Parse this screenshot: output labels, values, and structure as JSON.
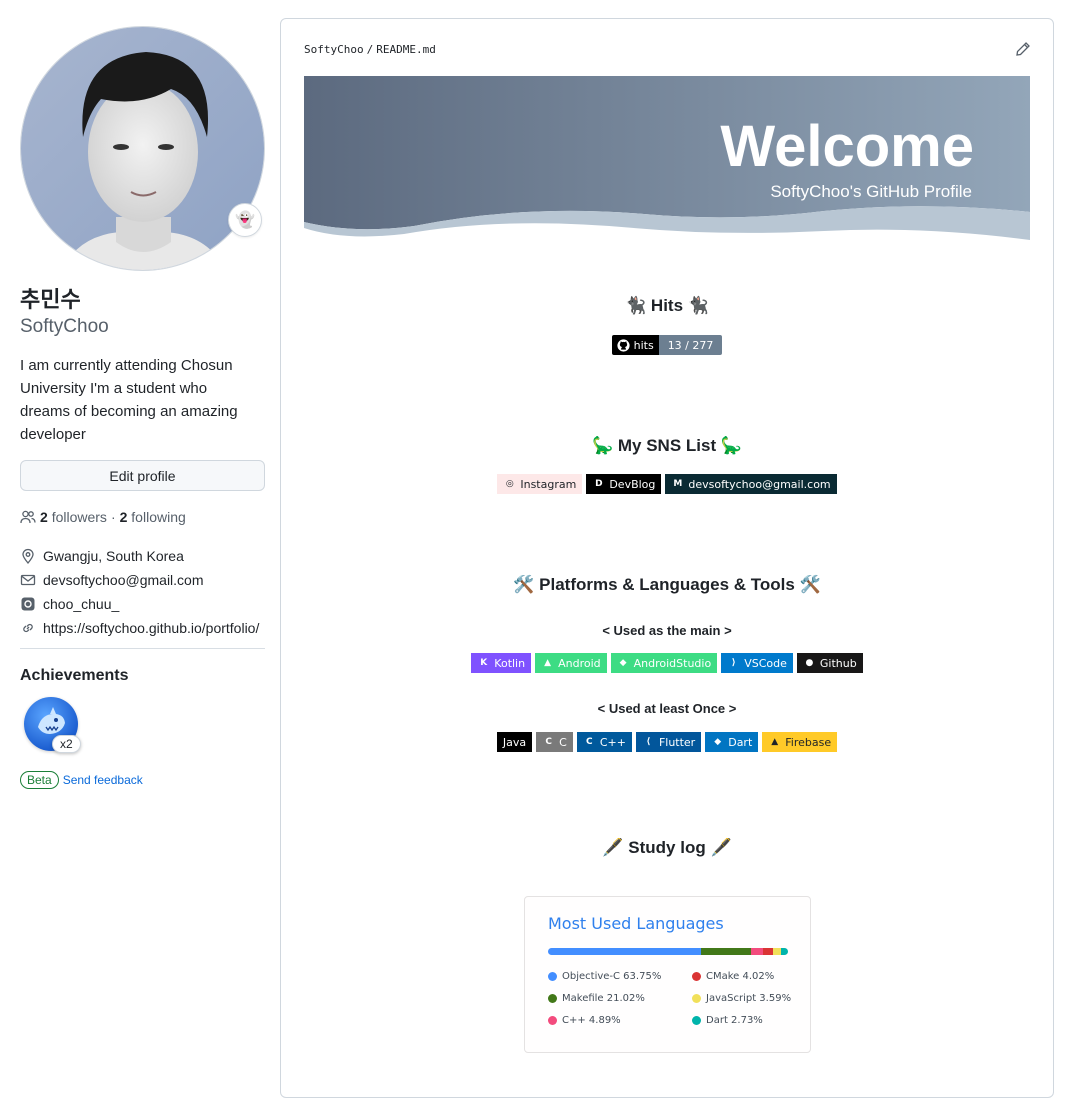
{
  "profile": {
    "full_name": "추민수",
    "username": "SoftyChoo",
    "bio": "I am currently attending Chosun University I'm a student who dreams of becoming an amazing developer",
    "edit_label": "Edit profile",
    "followers_count": "2",
    "followers_label": "followers",
    "separator": "·",
    "following_count": "2",
    "following_label": "following",
    "status_emoji": "👻",
    "details": {
      "location": "Gwangju, South Korea",
      "email": "devsoftychoo@gmail.com",
      "instagram": "choo_chuu_",
      "website": "https://softychoo.github.io/portfolio/"
    },
    "achievements_title": "Achievements",
    "achievement_count": "x2",
    "beta_label": "Beta",
    "feedback_label": "Send feedback"
  },
  "readme": {
    "owner": "SoftyChoo",
    "separator": "/",
    "file": "README.md",
    "banner_title": "Welcome",
    "banner_subtitle": "SoftyChoo's GitHub Profile",
    "hits": {
      "title": "🐈‍⬛ Hits 🐈‍⬛",
      "badge_label": "hits",
      "badge_value": "13 / 277"
    },
    "sns": {
      "title": "🦕 My SNS List 🦕",
      "badges": [
        {
          "label": "Instagram",
          "bg": "#fde8e8",
          "fg": "#1f2328",
          "icon": "instagram-icon"
        },
        {
          "label": "DevBlog",
          "bg": "#000000",
          "fg": "#ffffff",
          "icon": "devblog-icon"
        },
        {
          "label": "devsoftychoo@gmail.com",
          "bg": "#0a2a33",
          "fg": "#ffffff",
          "icon": "gmail-icon"
        }
      ]
    },
    "platforms": {
      "title": "🛠️ Platforms & Languages & Tools 🛠️",
      "main_title": "< Used as the main >",
      "main_badges": [
        {
          "label": "Kotlin",
          "bg": "#7f52ff",
          "icon": "kotlin-icon"
        },
        {
          "label": "Android",
          "bg": "#3ddc84",
          "icon": "android-icon"
        },
        {
          "label": "AndroidStudio",
          "bg": "#3ddc84",
          "icon": "androidstudio-icon"
        },
        {
          "label": "VSCode",
          "bg": "#007acc",
          "icon": "vscode-icon"
        },
        {
          "label": "Github",
          "bg": "#181717",
          "icon": "github-icon"
        }
      ],
      "once_title": "< Used at least Once >",
      "once_badges": [
        {
          "label": "Java",
          "bg": "#000000",
          "icon": ""
        },
        {
          "label": "C",
          "bg": "#7a7a7a",
          "icon": "c-icon"
        },
        {
          "label": "C++",
          "bg": "#00599c",
          "icon": "cpp-icon"
        },
        {
          "label": "Flutter",
          "bg": "#02569b",
          "icon": "flutter-icon"
        },
        {
          "label": "Dart",
          "bg": "#0175c2",
          "icon": "dart-icon"
        },
        {
          "label": "Firebase",
          "bg": "#ffca28",
          "fg": "#1f2328",
          "icon": "firebase-icon"
        }
      ]
    },
    "study": {
      "title": "🖋️ Study log 🖋️"
    },
    "languages_card": {
      "title": "Most Used Languages",
      "languages": [
        {
          "name": "Objective-C",
          "percent": 63.75,
          "label": "Objective-C 63.75%",
          "color": "#438eff"
        },
        {
          "name": "Makefile",
          "percent": 21.02,
          "label": "Makefile 21.02%",
          "color": "#427819"
        },
        {
          "name": "C++",
          "percent": 4.89,
          "label": "C++ 4.89%",
          "color": "#f34b7d"
        },
        {
          "name": "CMake",
          "percent": 4.02,
          "label": "CMake 4.02%",
          "color": "#da3434"
        },
        {
          "name": "JavaScript",
          "percent": 3.59,
          "label": "JavaScript 3.59%",
          "color": "#f1e05a"
        },
        {
          "name": "Dart",
          "percent": 2.73,
          "label": "Dart 2.73%",
          "color": "#00b4ab"
        }
      ]
    }
  }
}
